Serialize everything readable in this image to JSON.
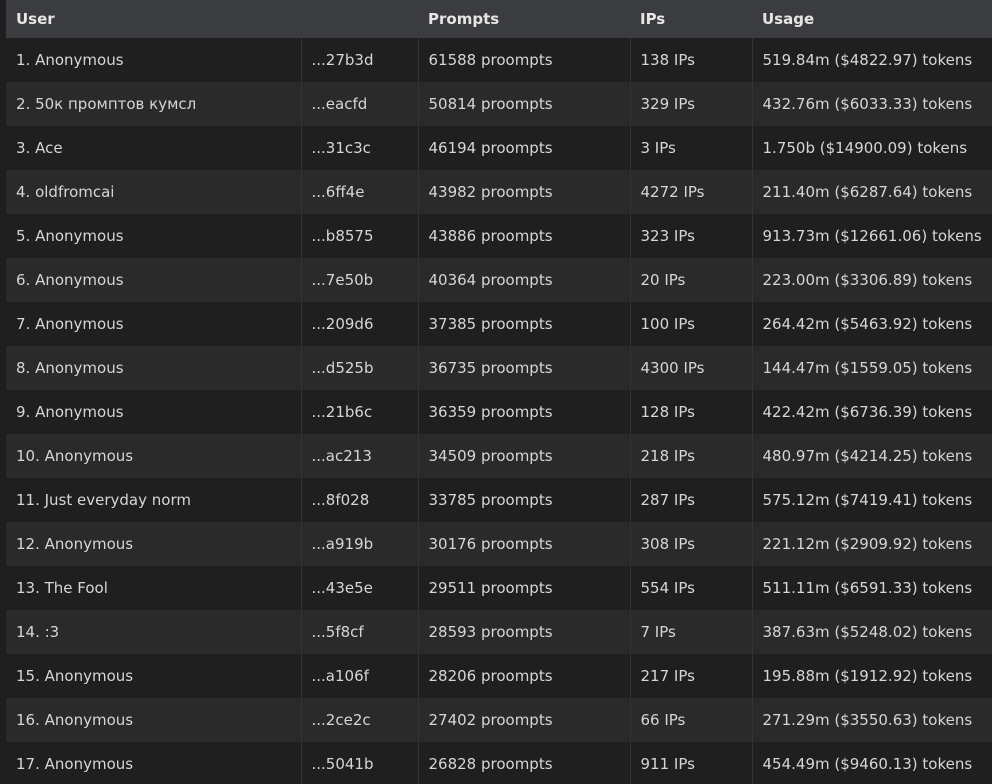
{
  "table": {
    "headers": [
      "User",
      "",
      "Prompts",
      "IPs",
      "Usage"
    ],
    "rows": [
      [
        "1. Anonymous",
        "...27b3d",
        "61588 proompts",
        "138 IPs",
        "519.84m ($4822.97) tokens"
      ],
      [
        "2. 50к промптов кумсл",
        "...eacfd",
        "50814 proompts",
        "329 IPs",
        "432.76m ($6033.33) tokens"
      ],
      [
        "3. Ace",
        "...31c3c",
        "46194 proompts",
        "3 IPs",
        "1.750b ($14900.09) tokens"
      ],
      [
        "4. oldfromcai",
        "...6ff4e",
        "43982 proompts",
        "4272 IPs",
        "211.40m ($6287.64) tokens"
      ],
      [
        "5. Anonymous",
        "...b8575",
        "43886 proompts",
        "323 IPs",
        "913.73m ($12661.06) tokens"
      ],
      [
        "6. Anonymous",
        "...7e50b",
        "40364 proompts",
        "20 IPs",
        "223.00m ($3306.89) tokens"
      ],
      [
        "7. Anonymous",
        "...209d6",
        "37385 proompts",
        "100 IPs",
        "264.42m ($5463.92) tokens"
      ],
      [
        "8. Anonymous",
        "...d525b",
        "36735 proompts",
        "4300 IPs",
        "144.47m ($1559.05) tokens"
      ],
      [
        "9. Anonymous",
        "...21b6c",
        "36359 proompts",
        "128 IPs",
        "422.42m ($6736.39) tokens"
      ],
      [
        "10. Anonymous",
        "...ac213",
        "34509 proompts",
        "218 IPs",
        "480.97m ($4214.25) tokens"
      ],
      [
        "11. Just everyday norm",
        "...8f028",
        "33785 proompts",
        "287 IPs",
        "575.12m ($7419.41) tokens"
      ],
      [
        "12. Anonymous",
        "...a919b",
        "30176 proompts",
        "308 IPs",
        "221.12m ($2909.92) tokens"
      ],
      [
        "13. The Fool",
        "...43e5e",
        "29511 proompts",
        "554 IPs",
        "511.11m ($6591.33) tokens"
      ],
      [
        "14. :3",
        "...5f8cf",
        "28593 proompts",
        "7 IPs",
        "387.63m ($5248.02) tokens"
      ],
      [
        "15. Anonymous",
        "...a106f",
        "28206 proompts",
        "217 IPs",
        "195.88m ($1912.92) tokens"
      ],
      [
        "16. Anonymous",
        "...2ce2c",
        "27402 proompts",
        "66 IPs",
        "271.29m ($3550.63) tokens"
      ],
      [
        "17. Anonymous",
        "...5041b",
        "26828 proompts",
        "911 IPs",
        "454.49m ($9460.13) tokens"
      ]
    ]
  }
}
